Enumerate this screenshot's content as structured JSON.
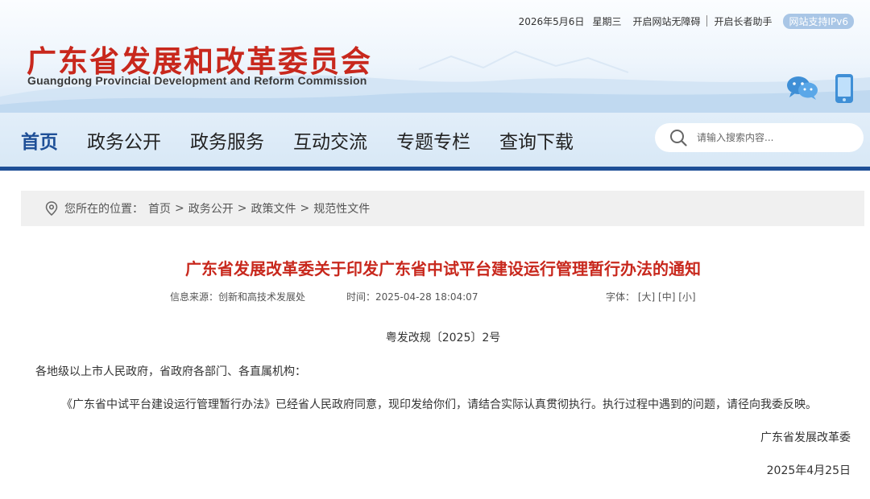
{
  "header": {
    "site_title": "广东省发展和改革委员会",
    "site_subtitle": "Guangdong Provincial Development and Reform Commission",
    "date": "2026年5月6日",
    "weekday": "星期三",
    "accessibility_link": "开启网站无障碍",
    "elderly_link": "开启长者助手",
    "ipv6_badge": "网站支持IPv6",
    "brand_red": "#c8281d",
    "brand_blue": "#1e4f97",
    "icons": [
      "wechat-icon",
      "mobile-icon"
    ]
  },
  "nav": {
    "items": [
      {
        "label": "首页",
        "active": true
      },
      {
        "label": "政务公开",
        "active": false
      },
      {
        "label": "政务服务",
        "active": false
      },
      {
        "label": "互动交流",
        "active": false
      },
      {
        "label": "专题专栏",
        "active": false
      },
      {
        "label": "查询下载",
        "active": false
      }
    ],
    "search_placeholder": "请输入搜索内容..."
  },
  "breadcrumb": {
    "prefix": "您所在的位置：",
    "items": [
      "首页",
      "政务公开",
      "政策文件",
      "规范性文件"
    ],
    "separator": ">"
  },
  "article": {
    "title": "广东省发展改革委关于印发广东省中试平台建设运行管理暂行办法的通知",
    "source": "信息来源：创新和高技术发展处",
    "time": "时间：2025-04-28 18:04:07",
    "font_label": "字体：",
    "font_sizes": [
      "[大]",
      "[中]",
      "[小]"
    ],
    "doc_number": "粤发改规〔2025〕2号",
    "salutation": "各地级以上市人民政府，省政府各部门、各直属机构：",
    "body": "《广东省中试平台建设运行管理暂行办法》已经省人民政府同意，现印发给你们，请结合实际认真贯彻执行。执行过程中遇到的问题，请径向我委反映。",
    "signature": "广东省发展改革委",
    "sign_date": "2025年4月25日"
  }
}
